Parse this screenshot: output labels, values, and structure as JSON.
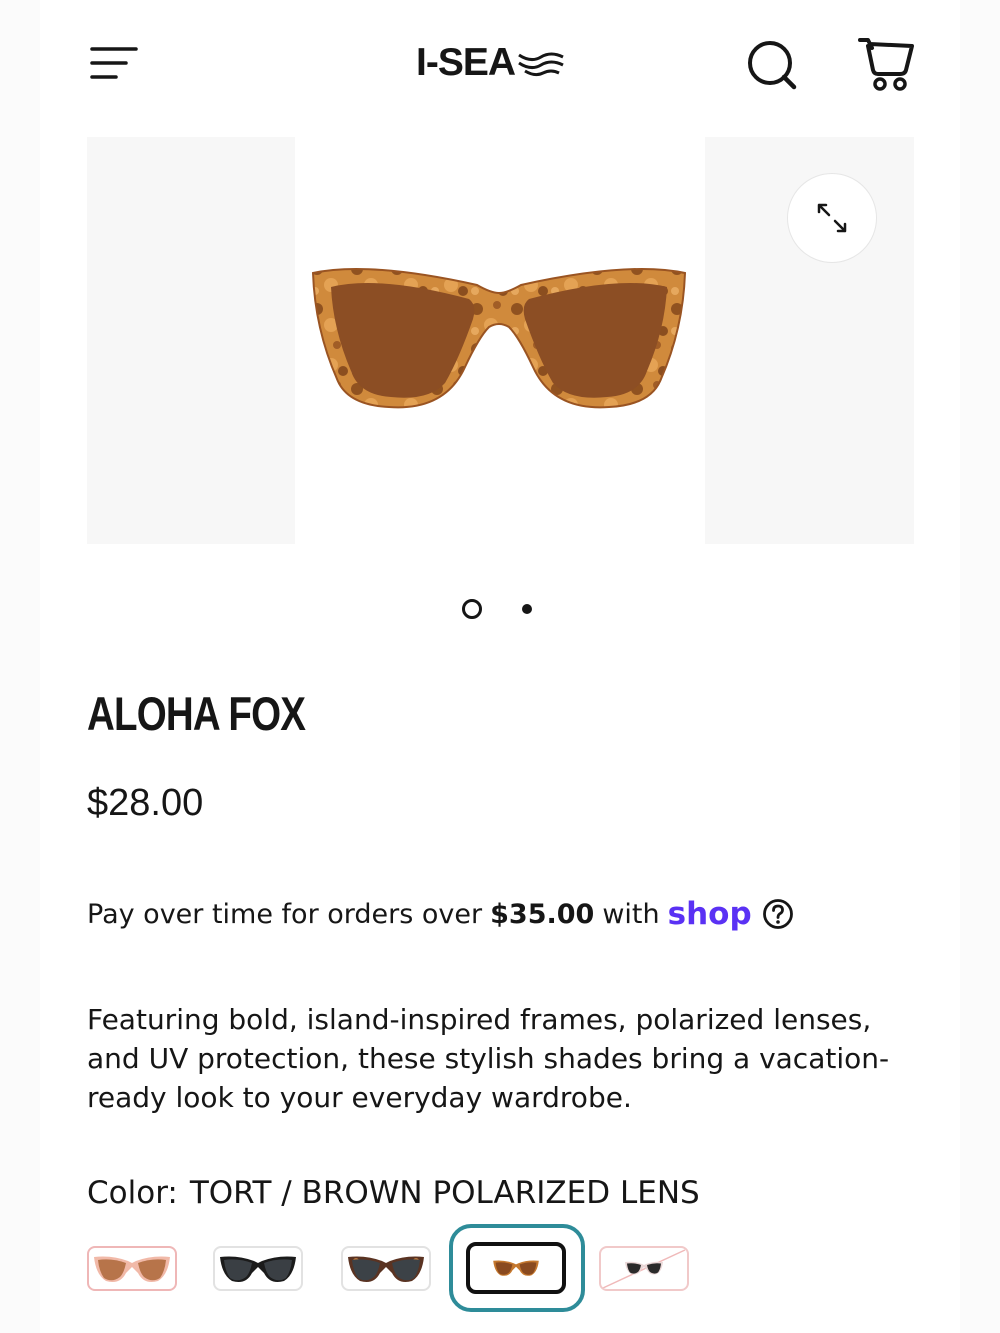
{
  "header": {
    "logo": "I-SEA",
    "icons": {
      "menu": "hamburger-menu-icon",
      "search": "search-icon",
      "cart": "cart-icon"
    }
  },
  "gallery": {
    "current_slide": 1,
    "slide_count": 2,
    "expand_icon": "expand-arrows-icon"
  },
  "product": {
    "title": "ALOHA FOX",
    "price": "$28.00",
    "installments": {
      "prefix": "Pay over time for orders over",
      "amount": "$35.00",
      "mid": "with",
      "provider": "shop",
      "help_icon": "question-circle-icon"
    },
    "description": "Featuring bold, island-inspired frames, polarized lenses, and UV protection, these stylish shades bring a vacation-ready look to your everyday wardrobe."
  },
  "color": {
    "label": "Color:",
    "selected": "TORT / BROWN POLARIZED LENS",
    "selected_index": 3,
    "swatches": [
      {
        "name": "pink-brown",
        "frame": "#f1b9a8",
        "lens": "#b7744a"
      },
      {
        "name": "black-grey",
        "frame": "#1b1b1b",
        "lens": "#3a3f44"
      },
      {
        "name": "tort-grey",
        "frame": "#5a3322",
        "lens": "#3c4247"
      },
      {
        "name": "tort-brown",
        "frame": "#c5782e",
        "lens": "#8a4a1f"
      },
      {
        "name": "clear-grey",
        "frame": "#f0c5c5",
        "lens": "#2b2b2b"
      }
    ]
  },
  "colors": {
    "accent": "#2e8c99",
    "shop_purple": "#5a31f4",
    "text": "#161616"
  }
}
